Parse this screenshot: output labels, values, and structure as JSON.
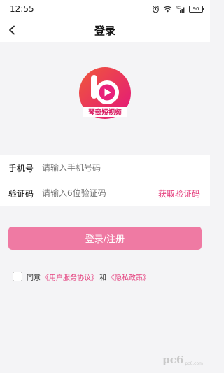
{
  "status_bar": {
    "time": "12:55",
    "network_label": "4G",
    "battery_level": "90"
  },
  "nav": {
    "title": "登录"
  },
  "logo": {
    "app_name": "琴郵短视频",
    "colors": {
      "primary": "#e8207a",
      "secondary": "#f05a3c"
    }
  },
  "form": {
    "phone": {
      "label": "手机号",
      "placeholder": "请输入手机号码",
      "value": ""
    },
    "code": {
      "label": "验证码",
      "placeholder": "请输入6位验证码",
      "value": "",
      "action": "获取验证码"
    }
  },
  "login_button": {
    "label": "登录/注册"
  },
  "agreement": {
    "checked": false,
    "prefix": "同意",
    "user_agreement": "《用户服务协议》",
    "and": "和",
    "privacy_policy": "《隐私政策》"
  },
  "watermark": {
    "mark": "pc6",
    "url": "pc6.com"
  },
  "colors": {
    "accent": "#e5407e",
    "button": "#ef7aa3",
    "background": "#f4f4f6"
  }
}
